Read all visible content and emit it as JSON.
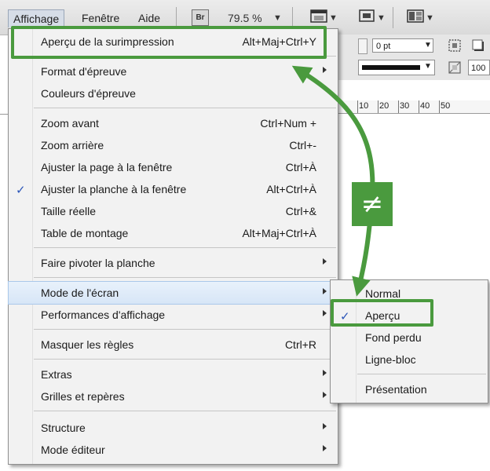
{
  "menubar": {
    "items": [
      {
        "label": "Affichage"
      },
      {
        "label": "Fenêtre"
      },
      {
        "label": "Aide"
      }
    ],
    "bridge_badge": "Br",
    "zoom": "79.5 %",
    "icons": [
      "screen-mode-icon",
      "view-options-icon",
      "arrange-documents-icon"
    ]
  },
  "control_panel": {
    "stroke_weight": "0 pt",
    "percent": "100"
  },
  "ruler": {
    "ticks": [
      "10",
      "20",
      "30",
      "40",
      "50"
    ]
  },
  "main_menu": {
    "groups": [
      [
        {
          "label": "Aperçu de la surimpression",
          "shortcut": "Alt+Maj+Ctrl+Y"
        }
      ],
      [
        {
          "label": "Format d'épreuve",
          "submenu": true
        },
        {
          "label": "Couleurs d'épreuve"
        }
      ],
      [
        {
          "label": "Zoom avant",
          "shortcut": "Ctrl+Num +"
        },
        {
          "label": "Zoom arrière",
          "shortcut": "Ctrl+-"
        },
        {
          "label": "Ajuster la page à la fenêtre",
          "shortcut": "Ctrl+À"
        },
        {
          "label": "Ajuster la planche à la fenêtre",
          "shortcut": "Alt+Ctrl+À",
          "checked": true
        },
        {
          "label": "Taille réelle",
          "shortcut": "Ctrl+&"
        },
        {
          "label": "Table de montage",
          "shortcut": "Alt+Maj+Ctrl+À"
        }
      ],
      [
        {
          "label": "Faire pivoter la planche",
          "submenu": true
        }
      ],
      [
        {
          "label": "Mode de l'écran",
          "submenu": true,
          "highlighted": true
        },
        {
          "label": "Performances d'affichage",
          "submenu": true
        }
      ],
      [
        {
          "label": "Masquer les règles",
          "shortcut": "Ctrl+R"
        }
      ],
      [
        {
          "label": "Extras",
          "submenu": true
        },
        {
          "label": "Grilles et repères",
          "submenu": true
        }
      ],
      [
        {
          "label": "Structure",
          "submenu": true
        },
        {
          "label": "Mode éditeur",
          "submenu": true
        }
      ]
    ]
  },
  "screen_mode_submenu": {
    "items": [
      {
        "label": "Normal"
      },
      {
        "label": "Aperçu",
        "checked": true
      },
      {
        "label": "Fond perdu"
      },
      {
        "label": "Ligne-bloc"
      },
      {
        "label": "Présentation"
      }
    ]
  },
  "annotation": {
    "symbol": "≠",
    "color": "#4a9a3e"
  },
  "colors": {
    "highlight": "#d7e6f7",
    "check": "#2b55b8",
    "annotation_green": "#4a9a3e"
  }
}
